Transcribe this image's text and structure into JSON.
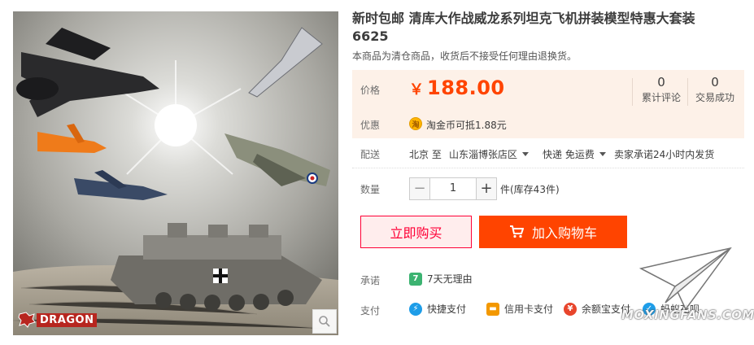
{
  "product": {
    "title_line1": "新时包邮 清库大作战威龙系列坦克飞机拼装模型特惠大套装",
    "title_line2": "6625",
    "notice": "本商品为清仓商品，收货后不接受任何理由退换货。"
  },
  "image": {
    "brand": "DRAGON"
  },
  "price": {
    "label": "价格",
    "currency": "￥",
    "value": "188.00",
    "color": "#ff4400"
  },
  "stats": [
    {
      "count": "0",
      "label": "累计评论"
    },
    {
      "count": "0",
      "label": "交易成功"
    }
  ],
  "promo": {
    "label": "优惠",
    "icon_text": "淘",
    "text": "淘金币可抵1.88元"
  },
  "shipping": {
    "label": "配送",
    "from": "北京 至",
    "to": "山东淄博张店区",
    "method": "快递 免运费",
    "promise": "卖家承诺24小时内发货"
  },
  "quantity": {
    "label": "数量",
    "minus": "−",
    "value": "1",
    "plus": "+",
    "stock": "件(库存43件)"
  },
  "actions": {
    "buy_now": "立即购买",
    "add_to_cart": "加入购物车",
    "buy_color": "#ff0036",
    "cart_color": "#ff4400"
  },
  "promise": {
    "label": "承诺",
    "item": "7天无理由"
  },
  "payment": {
    "label": "支付",
    "methods": [
      "快捷支付",
      "信用卡支付",
      "余额宝支付",
      "蚂蚁花呗"
    ]
  },
  "watermark": {
    "text": "MOXINGFANS.COM"
  }
}
